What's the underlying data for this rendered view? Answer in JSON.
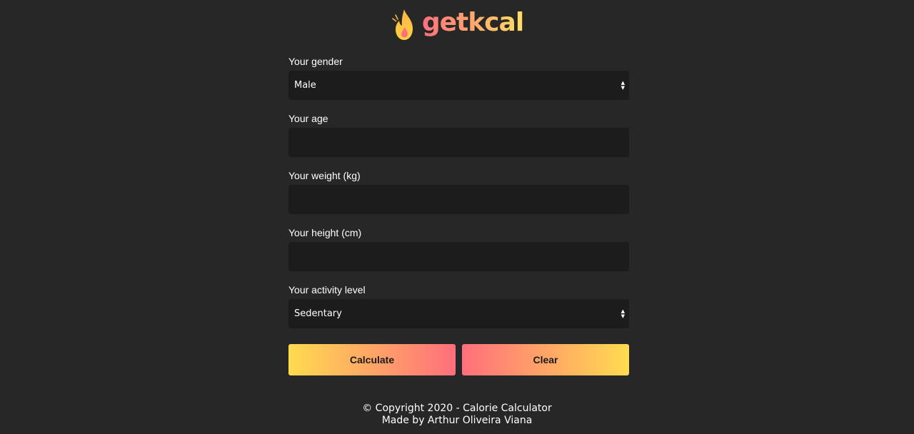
{
  "brand": {
    "name": "getkcal",
    "icon": "flame-icon",
    "colors": {
      "gradient_start": "#ff6f7c",
      "gradient_end": "#ffe066"
    }
  },
  "form": {
    "gender": {
      "label": "Your gender",
      "value": "Male"
    },
    "age": {
      "label": "Your age",
      "value": ""
    },
    "weight": {
      "label": "Your weight (kg)",
      "value": ""
    },
    "height": {
      "label": "Your height (cm)",
      "value": ""
    },
    "activity": {
      "label": "Your activity level",
      "value": "Sedentary"
    }
  },
  "buttons": {
    "calculate_label": "Calculate",
    "clear_label": "Clear"
  },
  "footer": {
    "copyright": "© Copyright 2020 - Calorie Calculator",
    "author": "Made by Arthur Oliveira Viana"
  },
  "theme": {
    "background": "#272727",
    "field_background": "#1c1c1c",
    "text": "#ffffff"
  }
}
